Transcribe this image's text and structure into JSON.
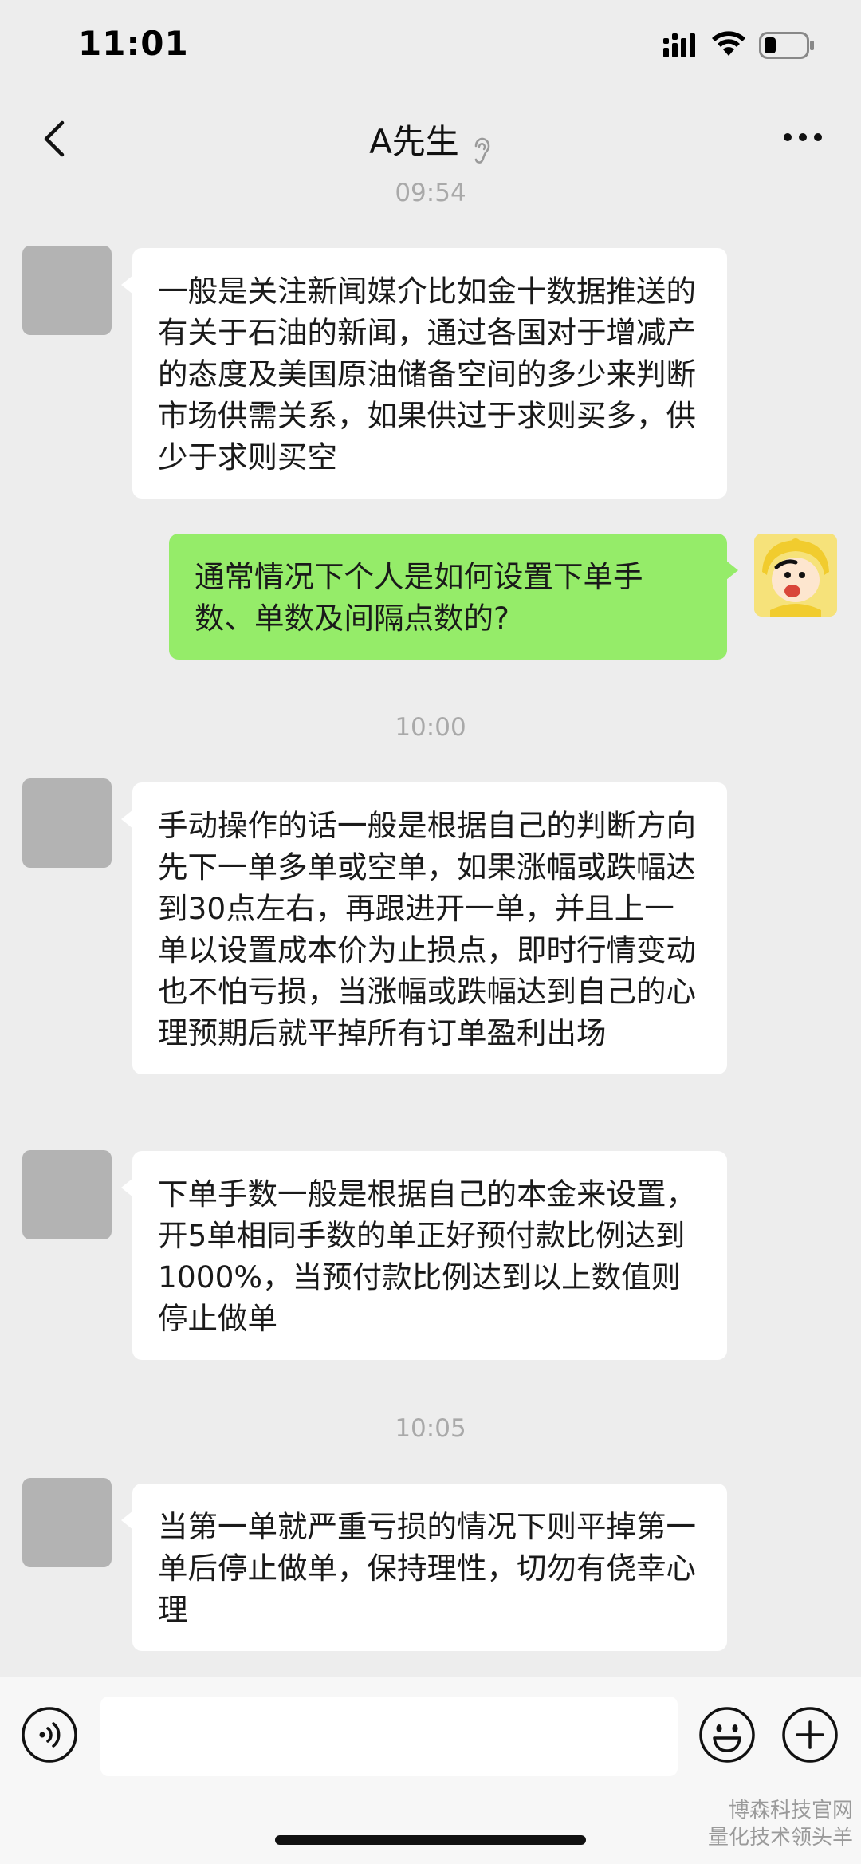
{
  "status_bar": {
    "time": "11:01"
  },
  "nav": {
    "title": "A先生",
    "icons": [
      "back-icon",
      "ear-icon",
      "more-icon"
    ]
  },
  "messages": [
    {
      "type": "timestamp",
      "text": "09:54"
    },
    {
      "type": "incoming",
      "text": "一般是关注新闻媒介比如金十数据推送的有关于石油的新闻，通过各国对于增减产的态度及美国原油储备空间的多少来判断市场供需关系，如果供过于求则买多，供少于求则买空"
    },
    {
      "type": "outgoing",
      "text": "通常情况下个人是如何设置下单手数、单数及间隔点数的?"
    },
    {
      "type": "timestamp",
      "text": "10:00"
    },
    {
      "type": "incoming",
      "text": "手动操作的话一般是根据自己的判断方向先下一单多单或空单，如果涨幅或跌幅达到30点左右，再跟进开一单，并且上一单以设置成本价为止损点，即时行情变动也不怕亏损，当涨幅或跌幅达到自己的心理预期后就平掉所有订单盈利出场"
    },
    {
      "type": "incoming",
      "text": "下单手数一般是根据自己的本金来设置，开5单相同手数的单正好预付款比例达到1000%，当预付款比例达到以上数值则停止做单"
    },
    {
      "type": "timestamp",
      "text": "10:05"
    },
    {
      "type": "incoming",
      "text": "当第一单就严重亏损的情况下则平掉第一单后停止做单，保持理性，切勿有侥幸心理"
    }
  ],
  "input_bar": {
    "input_value": "",
    "icons": [
      "voice-icon",
      "emoji-icon",
      "plus-icon"
    ]
  },
  "watermark": {
    "line1": "博森科技官网",
    "line2": "量化技术领头羊"
  },
  "colors": {
    "background": "#ededed",
    "outgoing_bubble": "#95ec69",
    "incoming_bubble": "#ffffff",
    "timestamp_text": "#a9a9a9",
    "avatar_placeholder": "#b3b3b3"
  }
}
